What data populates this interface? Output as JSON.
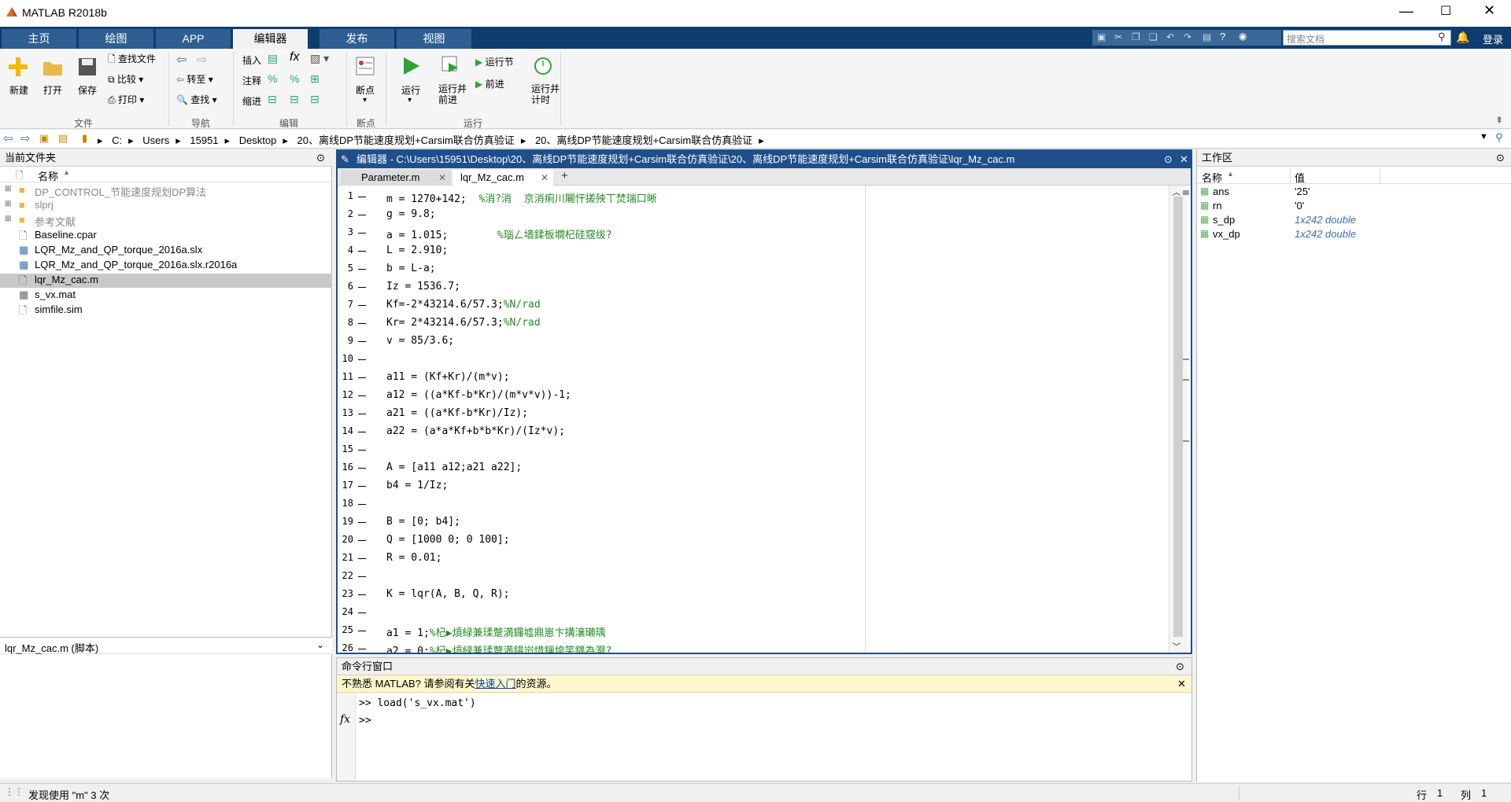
{
  "window": {
    "title": "MATLAB R2018b",
    "login": "登录",
    "search_placeholder": "搜索文档"
  },
  "tabs": [
    {
      "label": "主页"
    },
    {
      "label": "绘图"
    },
    {
      "label": "APP"
    },
    {
      "label": "编辑器"
    },
    {
      "label": "发布"
    },
    {
      "label": "视图"
    }
  ],
  "ribbon": {
    "new": "新建",
    "open": "打开",
    "save": "保存",
    "find_files": "查找文件",
    "compare": "比较",
    "print": "打印",
    "goto": "转至",
    "find": "查找",
    "insert": "插入",
    "comment": "注释",
    "indent": "缩进",
    "breakpoints": "断点",
    "run": "运行",
    "run_advance": "运行并\n前进",
    "run_section": "运行节",
    "advance": "前进",
    "run_time": "运行并\n计时",
    "groups": {
      "file": "文件",
      "nav": "导航",
      "edit": "编辑",
      "breakpoints": "断点",
      "run": "运行"
    }
  },
  "address": {
    "items": [
      "C:",
      "Users",
      "15951",
      "Desktop",
      "20、离线DP节能速度规划+Carsim联合仿真验证",
      "20、离线DP节能速度规划+Carsim联合仿真验证"
    ]
  },
  "current_folder": {
    "title": "当前文件夹",
    "col_name": "名称",
    "files": [
      "DP_CONTROL_节能速度规划DP算法",
      "slprj",
      "参考文献",
      "Baseline.cpar",
      "LQR_Mz_and_QP_torque_2016a.slx",
      "LQR_Mz_and_QP_torque_2016a.slx.r2016a",
      "lqr_Mz_cac.m",
      "s_vx.mat",
      "simfile.sim"
    ],
    "detail_title": "lqr_Mz_cac.m (脚本)"
  },
  "editor": {
    "title": "编辑器 - C:\\Users\\15951\\Desktop\\20、离线DP节能速度规划+Carsim联合仿真验证\\20、离线DP节能速度规划+Carsim联合仿真验证\\lqr_Mz_cac.m",
    "tabs": [
      "Parameter.m",
      "lqr_Mz_cac.m"
    ],
    "lines": [
      {
        "n": "1",
        "code": "m = 1270+142;",
        "cm": "  %消?消  京消痢川闀忓搓殃丅焚瑞口晰"
      },
      {
        "n": "2",
        "code": "g = 9.8;",
        "cm": ""
      },
      {
        "n": "3",
        "code": "a = 1.015;",
        "cm": "        %瑙ㄥ墙鍒板墹杞硅窛绂?"
      },
      {
        "n": "4",
        "code": "L = 2.910;",
        "cm": ""
      },
      {
        "n": "5",
        "code": "b = L-a;",
        "cm": ""
      },
      {
        "n": "6",
        "code": "Iz = 1536.7;",
        "cm": ""
      },
      {
        "n": "7",
        "code": "Kf=-2*43214.6/57.3;",
        "cm": "%N/rad"
      },
      {
        "n": "8",
        "code": "Kr= 2*43214.6/57.3;",
        "cm": "%N/rad"
      },
      {
        "n": "9",
        "code": "v = 85/3.6;",
        "cm": ""
      },
      {
        "n": "10",
        "code": "",
        "cm": ""
      },
      {
        "n": "11",
        "code": "a11 = (Kf+Kr)/(m*v);",
        "cm": ""
      },
      {
        "n": "12",
        "code": "a12 = ((a*Kf-b*Kr)/(m*v*v))-1;",
        "cm": ""
      },
      {
        "n": "13",
        "code": "a21 = ((a*Kf-b*Kr)/Iz);",
        "cm": ""
      },
      {
        "n": "14",
        "code": "a22 = (a*a*Kf+b*b*Kr)/(Iz*v);",
        "cm": ""
      },
      {
        "n": "15",
        "code": "",
        "cm": ""
      },
      {
        "n": "16",
        "code": "A = [a11 a12;a21 a22];",
        "cm": ""
      },
      {
        "n": "17",
        "code": "b4 = 1/Iz;",
        "cm": ""
      },
      {
        "n": "18",
        "code": "",
        "cm": ""
      },
      {
        "n": "19",
        "code": "B = [0; b4];",
        "cm": ""
      },
      {
        "n": "20",
        "code": "Q = [1000 0; 0 100];",
        "cm": ""
      },
      {
        "n": "21",
        "code": "R = 0.01;",
        "cm": ""
      },
      {
        "n": "22",
        "code": "",
        "cm": ""
      },
      {
        "n": "23",
        "code": "K = lqr(A, B, Q, R);",
        "cm": ""
      },
      {
        "n": "24",
        "code": "",
        "cm": ""
      },
      {
        "n": "25",
        "code": "a1 = 1;",
        "cm": "%杞▶熕緑兼瑈蹩満鑼墟鼎崽卞搆瀼瓎瑀"
      },
      {
        "n": "26",
        "code": "a2 = 0;",
        "cm": "%杞▶熕緑兼瑈蹩満鍚岃惜鏁垮笑鍝為灏?"
      }
    ]
  },
  "command": {
    "title": "命令行窗口",
    "notice_pre": "不熟悉 MATLAB? 请参阅有关",
    "notice_link": "快速入门",
    "notice_post": "的资源。",
    "history": ">> load('s_vx.mat')",
    "prompt": ">>",
    "fx": "fx"
  },
  "workspace": {
    "title": "工作区",
    "col_name": "名称",
    "col_value": "值",
    "vars": [
      {
        "name": "ans",
        "value": "'25'"
      },
      {
        "name": "rn",
        "value": "'0'"
      },
      {
        "name": "s_dp",
        "value": "1x242 double"
      },
      {
        "name": "vx_dp",
        "value": "1x242 double"
      }
    ]
  },
  "status": {
    "message": "发现使用 \"m\" 3 次",
    "row_label": "行",
    "row": "1",
    "col_label": "列",
    "col": "1"
  },
  "colors": {
    "tabbar": "#0e3c6e",
    "accent": "#1e4f8a"
  }
}
